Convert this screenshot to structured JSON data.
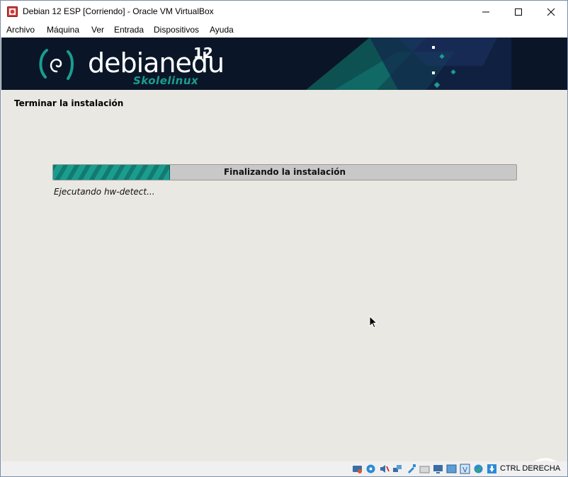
{
  "window": {
    "title": "Debian 12 ESP [Corriendo] - Oracle VM VirtualBox"
  },
  "menu": [
    "Archivo",
    "Máquina",
    "Ver",
    "Entrada",
    "Dispositivos",
    "Ayuda"
  ],
  "banner": {
    "logo_text": "debianedu",
    "version": "12",
    "subtitle": "Skolelinux"
  },
  "installer": {
    "section_title": "Terminar la instalación",
    "progress_label": "Finalizando la instalación",
    "progress_status": "Ejecutando hw-detect...",
    "progress_fraction": 0.25
  },
  "statusbar": {
    "host_key": "CTRL DERECHA",
    "icons": [
      "hard-disk-icon",
      "optical-drive-icon",
      "audio-icon",
      "network-icon",
      "usb-icon",
      "shared-folders-icon",
      "display-icon",
      "video-capture-icon",
      "mouse-integration-icon",
      "guest-additions-icon",
      "keyboard-icon"
    ]
  },
  "colors": {
    "accent": "#1a9d8f",
    "banner_bg": "#0a1628",
    "screen_bg": "#eae8e2"
  }
}
